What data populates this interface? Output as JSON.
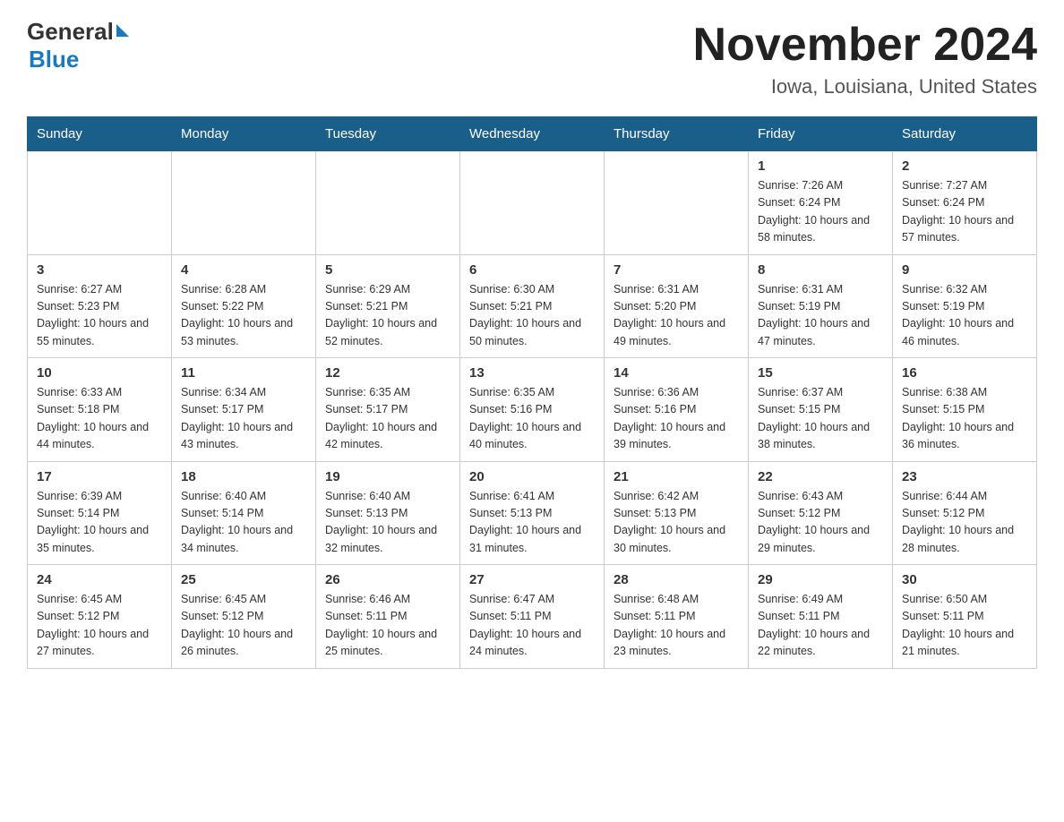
{
  "logo": {
    "general": "General",
    "blue": "Blue"
  },
  "title": "November 2024",
  "subtitle": "Iowa, Louisiana, United States",
  "days": [
    "Sunday",
    "Monday",
    "Tuesday",
    "Wednesday",
    "Thursday",
    "Friday",
    "Saturday"
  ],
  "weeks": [
    [
      {
        "num": "",
        "info": ""
      },
      {
        "num": "",
        "info": ""
      },
      {
        "num": "",
        "info": ""
      },
      {
        "num": "",
        "info": ""
      },
      {
        "num": "",
        "info": ""
      },
      {
        "num": "1",
        "info": "Sunrise: 7:26 AM\nSunset: 6:24 PM\nDaylight: 10 hours and 58 minutes."
      },
      {
        "num": "2",
        "info": "Sunrise: 7:27 AM\nSunset: 6:24 PM\nDaylight: 10 hours and 57 minutes."
      }
    ],
    [
      {
        "num": "3",
        "info": "Sunrise: 6:27 AM\nSunset: 5:23 PM\nDaylight: 10 hours and 55 minutes."
      },
      {
        "num": "4",
        "info": "Sunrise: 6:28 AM\nSunset: 5:22 PM\nDaylight: 10 hours and 53 minutes."
      },
      {
        "num": "5",
        "info": "Sunrise: 6:29 AM\nSunset: 5:21 PM\nDaylight: 10 hours and 52 minutes."
      },
      {
        "num": "6",
        "info": "Sunrise: 6:30 AM\nSunset: 5:21 PM\nDaylight: 10 hours and 50 minutes."
      },
      {
        "num": "7",
        "info": "Sunrise: 6:31 AM\nSunset: 5:20 PM\nDaylight: 10 hours and 49 minutes."
      },
      {
        "num": "8",
        "info": "Sunrise: 6:31 AM\nSunset: 5:19 PM\nDaylight: 10 hours and 47 minutes."
      },
      {
        "num": "9",
        "info": "Sunrise: 6:32 AM\nSunset: 5:19 PM\nDaylight: 10 hours and 46 minutes."
      }
    ],
    [
      {
        "num": "10",
        "info": "Sunrise: 6:33 AM\nSunset: 5:18 PM\nDaylight: 10 hours and 44 minutes."
      },
      {
        "num": "11",
        "info": "Sunrise: 6:34 AM\nSunset: 5:17 PM\nDaylight: 10 hours and 43 minutes."
      },
      {
        "num": "12",
        "info": "Sunrise: 6:35 AM\nSunset: 5:17 PM\nDaylight: 10 hours and 42 minutes."
      },
      {
        "num": "13",
        "info": "Sunrise: 6:35 AM\nSunset: 5:16 PM\nDaylight: 10 hours and 40 minutes."
      },
      {
        "num": "14",
        "info": "Sunrise: 6:36 AM\nSunset: 5:16 PM\nDaylight: 10 hours and 39 minutes."
      },
      {
        "num": "15",
        "info": "Sunrise: 6:37 AM\nSunset: 5:15 PM\nDaylight: 10 hours and 38 minutes."
      },
      {
        "num": "16",
        "info": "Sunrise: 6:38 AM\nSunset: 5:15 PM\nDaylight: 10 hours and 36 minutes."
      }
    ],
    [
      {
        "num": "17",
        "info": "Sunrise: 6:39 AM\nSunset: 5:14 PM\nDaylight: 10 hours and 35 minutes."
      },
      {
        "num": "18",
        "info": "Sunrise: 6:40 AM\nSunset: 5:14 PM\nDaylight: 10 hours and 34 minutes."
      },
      {
        "num": "19",
        "info": "Sunrise: 6:40 AM\nSunset: 5:13 PM\nDaylight: 10 hours and 32 minutes."
      },
      {
        "num": "20",
        "info": "Sunrise: 6:41 AM\nSunset: 5:13 PM\nDaylight: 10 hours and 31 minutes."
      },
      {
        "num": "21",
        "info": "Sunrise: 6:42 AM\nSunset: 5:13 PM\nDaylight: 10 hours and 30 minutes."
      },
      {
        "num": "22",
        "info": "Sunrise: 6:43 AM\nSunset: 5:12 PM\nDaylight: 10 hours and 29 minutes."
      },
      {
        "num": "23",
        "info": "Sunrise: 6:44 AM\nSunset: 5:12 PM\nDaylight: 10 hours and 28 minutes."
      }
    ],
    [
      {
        "num": "24",
        "info": "Sunrise: 6:45 AM\nSunset: 5:12 PM\nDaylight: 10 hours and 27 minutes."
      },
      {
        "num": "25",
        "info": "Sunrise: 6:45 AM\nSunset: 5:12 PM\nDaylight: 10 hours and 26 minutes."
      },
      {
        "num": "26",
        "info": "Sunrise: 6:46 AM\nSunset: 5:11 PM\nDaylight: 10 hours and 25 minutes."
      },
      {
        "num": "27",
        "info": "Sunrise: 6:47 AM\nSunset: 5:11 PM\nDaylight: 10 hours and 24 minutes."
      },
      {
        "num": "28",
        "info": "Sunrise: 6:48 AM\nSunset: 5:11 PM\nDaylight: 10 hours and 23 minutes."
      },
      {
        "num": "29",
        "info": "Sunrise: 6:49 AM\nSunset: 5:11 PM\nDaylight: 10 hours and 22 minutes."
      },
      {
        "num": "30",
        "info": "Sunrise: 6:50 AM\nSunset: 5:11 PM\nDaylight: 10 hours and 21 minutes."
      }
    ]
  ]
}
